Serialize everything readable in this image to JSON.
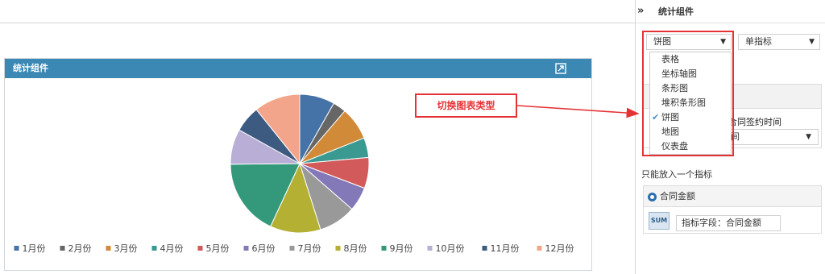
{
  "canvas": {
    "widget": {
      "title": "统计组件",
      "header_color": "#3b88b5"
    }
  },
  "annotation": {
    "text": "切换图表类型",
    "color": "#e53335"
  },
  "panel": {
    "toggle_glyph": "»",
    "title": "统计组件",
    "chart_type_select": {
      "value": "饼图"
    },
    "indicator_select": {
      "value": "单指标"
    },
    "chart_type_options": [
      {
        "label": "表格",
        "checked": false
      },
      {
        "label": "坐标轴图",
        "checked": false
      },
      {
        "label": "条形图",
        "checked": false
      },
      {
        "label": "堆积条形图",
        "checked": false
      },
      {
        "label": "饼图",
        "checked": true
      },
      {
        "label": "地图",
        "checked": false
      },
      {
        "label": "仪表盘",
        "checked": false
      }
    ],
    "dimension_field": "合同签约时间",
    "dimension_select_value": "间",
    "only_one_note": "只能放入一个指标",
    "measure": {
      "name": "合同金额",
      "icon_text": "SUM",
      "field_label": "指标字段：合同金额"
    }
  },
  "chart_data": {
    "type": "pie",
    "categories": [
      "1月份",
      "2月份",
      "3月份",
      "4月份",
      "5月份",
      "6月份",
      "7月份",
      "8月份",
      "9月份",
      "10月份",
      "11月份",
      "12月份"
    ],
    "values": [
      8.0,
      3.0,
      7.5,
      4.5,
      7.0,
      5.5,
      8.5,
      11.5,
      17.5,
      8.0,
      6.0,
      10.5
    ],
    "colors": [
      "#4572a7",
      "#666666",
      "#d08a38",
      "#3a9a91",
      "#d35a5a",
      "#8379b8",
      "#999999",
      "#b3b033",
      "#34997a",
      "#b8aed6",
      "#3d5a80",
      "#f2a58a"
    ],
    "legend": "bottom"
  }
}
